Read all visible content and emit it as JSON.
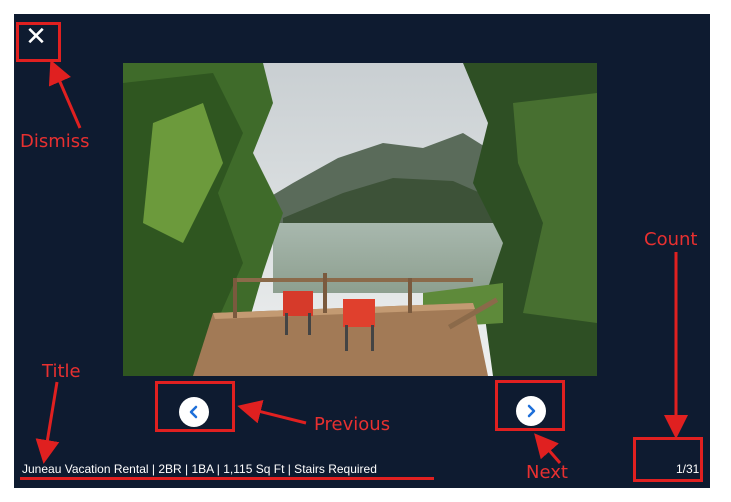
{
  "viewer": {
    "close_icon": "close-x-icon",
    "close_glyph": "✕",
    "prev_icon": "chevron-left-icon",
    "next_icon": "chevron-right-icon",
    "title": "Juneau Vacation Rental | 2BR | 1BA | 1,115 Sq Ft | Stairs Required",
    "count": "1/31",
    "background_color": "#0e1b30",
    "button_icon_color": "#1e6fd9"
  },
  "annotations": {
    "color": "#e02020",
    "dismiss": "Dismiss",
    "count": "Count",
    "title": "Title",
    "previous": "Previous",
    "next": "Next"
  }
}
